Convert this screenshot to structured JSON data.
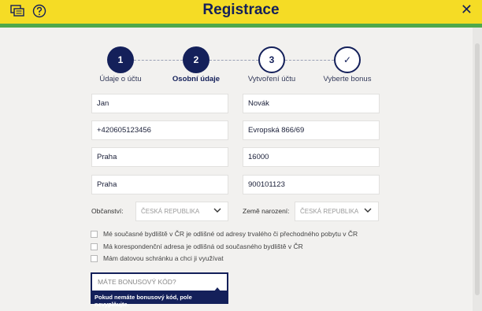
{
  "header": {
    "title": "Registrace",
    "icons": [
      "chat-icon",
      "help-icon",
      "close-icon"
    ],
    "close_glyph": "✕",
    "accent": "#f5dc25",
    "strip_color": "#4fa84b"
  },
  "steps": [
    {
      "number": "1",
      "label": "Údaje o účtu",
      "state": "done"
    },
    {
      "number": "2",
      "label": "Osobní údaje",
      "state": "current"
    },
    {
      "number": "3",
      "label": "Vytvoření účtu",
      "state": "todo"
    },
    {
      "number": "✓",
      "label": "Vyberte bonus",
      "state": "todo"
    }
  ],
  "form": {
    "first_name": "Jan",
    "last_name": "Novák",
    "phone": "+420605123456",
    "street": "Evropská 866/69",
    "city": "Praha",
    "zip": "16000",
    "birth_place": "Praha",
    "birth_number": "900101123",
    "citizenship_label": "Občanství:",
    "citizenship_value": "ČESKÁ REPUBLIKA",
    "birth_country_label": "Země narození:",
    "birth_country_value": "ČESKÁ REPUBLIKA"
  },
  "checkboxes": [
    {
      "label": "Mé současné bydliště v ČR je odlišné od adresy trvalého či přechodného pobytu v ČR",
      "checked": false
    },
    {
      "label": "Má korespondenční adresa je odlišná od současného bydliště v ČR",
      "checked": false
    },
    {
      "label": "Mám datovou schránku a chci ji využívat",
      "checked": false
    }
  ],
  "bonus": {
    "placeholder": "MÁTE BONUSOVÝ KÓD?",
    "hint": "Pokud nemáte bonusový kód, pole nevyplňujte."
  },
  "colors": {
    "navy": "#14205a"
  }
}
